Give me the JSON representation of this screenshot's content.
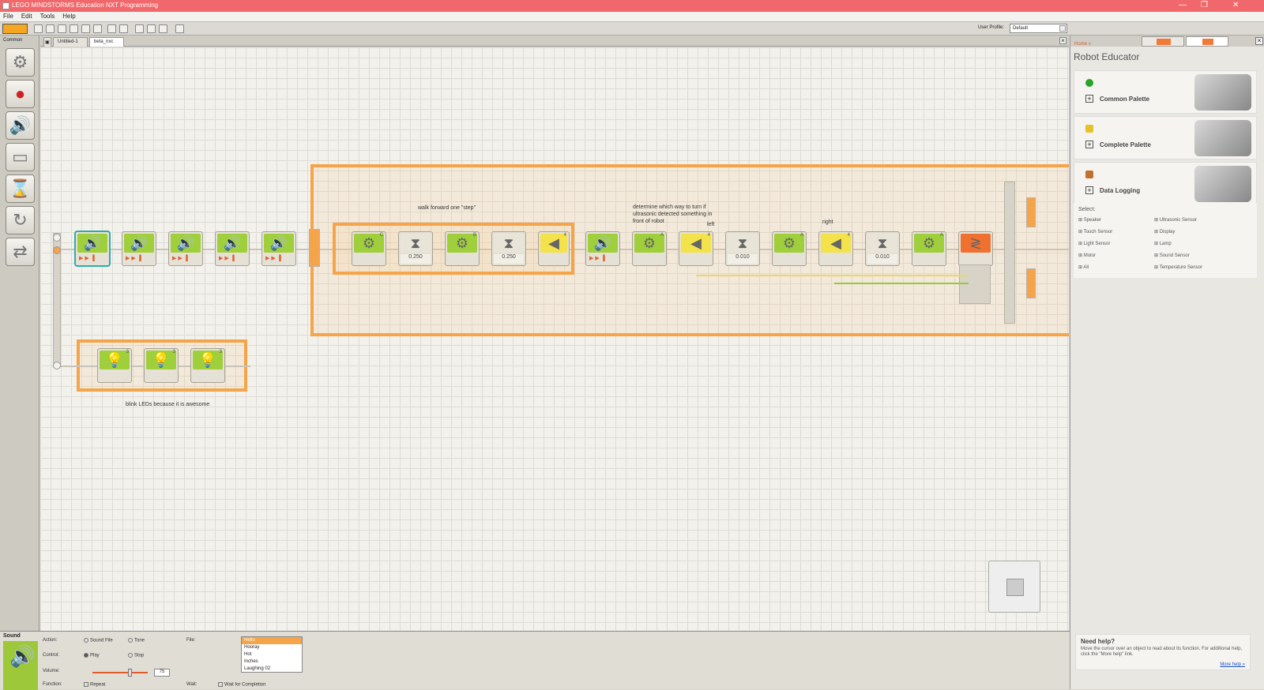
{
  "window": {
    "title": "LEGO MINDSTORMS Education NXT Programming",
    "controls": [
      "—",
      "❐",
      "✕"
    ]
  },
  "menu": [
    "File",
    "Edit",
    "Tools",
    "Help"
  ],
  "toolbar": {
    "user_profile_label": "User Profile:",
    "user_profile_value": "Default"
  },
  "palette": {
    "label": "Common"
  },
  "tabs": [
    {
      "label": "Untitled-1"
    },
    {
      "label": "beta_nxc"
    }
  ],
  "canvas": {
    "comments": {
      "walk": "walk forward one \"step\"",
      "determine": "determine which way to turn if ultrasonic detected something in front of robot",
      "left": "left",
      "right": "right",
      "blink": "blink LEDs because it is awesome"
    },
    "blocks": {
      "motor_c_port": "C",
      "wait_1": "0.250",
      "motor_b_port": "B",
      "wait_2": "0.250",
      "loop_count": "4",
      "motor_a1_port": "A",
      "sensor_left_port": "4",
      "wait_3": "0.010",
      "motor_a2_port": "A",
      "sensor_right_port": "4",
      "wait_4": "0.010",
      "motor_a3_port": "A",
      "lamp1_port": "3",
      "lamp2_port": "3",
      "lamp3_port": "3"
    }
  },
  "right_panel": {
    "breadcrumb": "Home »",
    "title": "Robot Educator",
    "cards": [
      {
        "label": "Common Palette",
        "icon": "green-circle",
        "color": "#2aa52a"
      },
      {
        "label": "Complete Palette",
        "icon": "yellow-blocks",
        "color": "#e8c02a"
      },
      {
        "label": "Data Logging",
        "icon": "chart",
        "color": "#c07030"
      }
    ],
    "select_label": "Select:",
    "select_items_left": [
      "Speaker",
      "Touch Sensor",
      "Light Sensor",
      "Motor",
      "All"
    ],
    "select_items_right": [
      "Ultrasonic Sensor",
      "Display",
      "Lamp",
      "Sound Sensor",
      "Temperature Sensor"
    ]
  },
  "config": {
    "block_name": "Sound",
    "action_label": "Action:",
    "action_opt1": "Sound File",
    "action_opt2": "Tone",
    "control_label": "Control:",
    "control_opt1": "Play",
    "control_opt2": "Stop",
    "volume_label": "Volume:",
    "volume_value": "75",
    "function_label": "Function:",
    "function_opt": "Repeat",
    "file_label": "File:",
    "files": [
      "Hello",
      "Hooray",
      "Hot",
      "Inches",
      "Laughing 02"
    ],
    "selected_file": "Hello",
    "wait_label": "Wait:",
    "wait_opt": "Wait for Completion"
  },
  "help": {
    "title": "Need help?",
    "body": "Move the cursor over an object to read about its function. For additional help, click the \"More help\" link.",
    "more": "More help »"
  },
  "colors": {
    "titlebar": "#f0686b",
    "accent": "#f5a44a",
    "block_green": "#9fcf3a"
  }
}
